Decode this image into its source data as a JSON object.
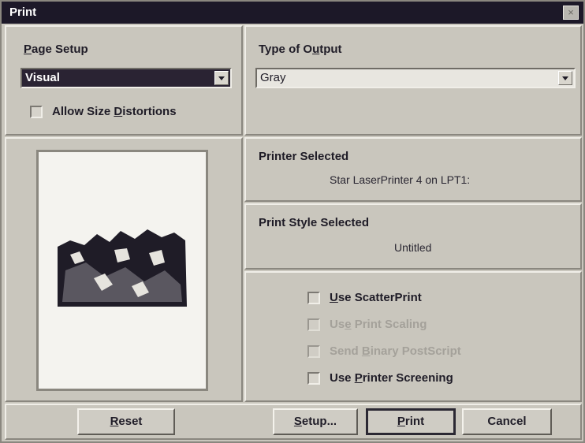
{
  "window": {
    "title": "Print",
    "close_glyph": "×"
  },
  "page_setup": {
    "label_prefix": "",
    "label_u": "P",
    "label_rest": "age Setup",
    "selected": "Visual",
    "allow_distortions": {
      "pre": "Allow Size ",
      "u": "D",
      "post": "istortions",
      "checked": false
    }
  },
  "output": {
    "label_pre": "Type of O",
    "label_u": "u",
    "label_post": "tput",
    "selected": "Gray"
  },
  "printer": {
    "label": "Printer Selected",
    "value": "Star LaserPrinter 4 on LPT1:"
  },
  "style": {
    "label": "Print Style Selected",
    "value": "Untitled"
  },
  "options": [
    {
      "pre": "",
      "u": "U",
      "post": "se ScatterPrint",
      "enabled": true,
      "checked": false
    },
    {
      "pre": "Us",
      "u": "e",
      "post": " Print Scaling",
      "enabled": false,
      "checked": false
    },
    {
      "pre": "Send ",
      "u": "B",
      "post": "inary PostScript",
      "enabled": false,
      "checked": false
    },
    {
      "pre": "Use ",
      "u": "P",
      "post": "rinter Screening",
      "enabled": true,
      "checked": false
    }
  ],
  "buttons": {
    "reset": {
      "u": "R",
      "rest": "eset"
    },
    "setup": {
      "u": "S",
      "rest": "etup..."
    },
    "print": {
      "u": "P",
      "rest": "rint"
    },
    "cancel": {
      "label": "Cancel"
    }
  },
  "colors": {
    "titlebar": "#1c1828",
    "dialog": "#c9c6bd",
    "select_highlight": "#2a2333"
  }
}
